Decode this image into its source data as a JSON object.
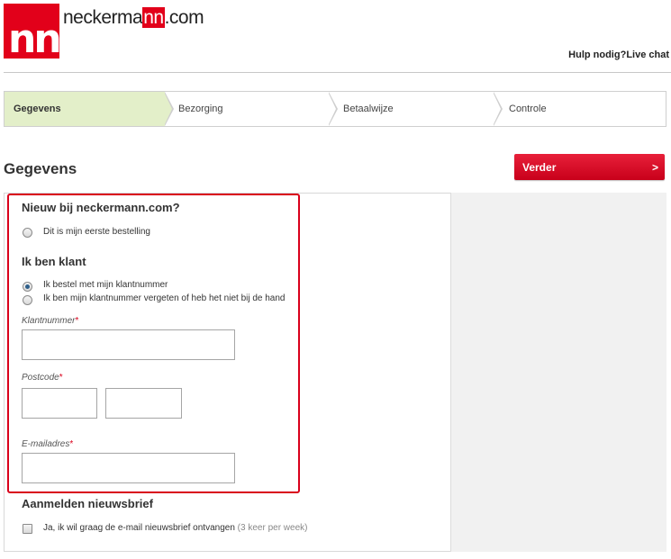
{
  "brand": {
    "logo_text": "nn",
    "name_prefix": "neckerma",
    "name_highlight": "nn",
    "name_suffix": ".com",
    "color": "#e2001a"
  },
  "header": {
    "help_label": "Hulp nodig?",
    "chat_label": "Live chat"
  },
  "steps": [
    {
      "label": "Gegevens",
      "active": true
    },
    {
      "label": "Bezorging",
      "active": false
    },
    {
      "label": "Betaalwijze",
      "active": false
    },
    {
      "label": "Controle",
      "active": false
    }
  ],
  "page": {
    "title": "Gegevens",
    "next_label": "Verder",
    "next_arrow": ">"
  },
  "new_customer": {
    "heading": "Nieuw bij neckermann.com?",
    "option_first_order": "Dit is mijn eerste bestelling"
  },
  "existing_customer": {
    "heading": "Ik ben klant",
    "option_with_number": "Ik bestel met mijn klantnummer",
    "option_forgot_number": "Ik ben mijn klantnummer vergeten of heb het niet bij de hand",
    "selected": "option_with_number"
  },
  "form": {
    "customer_number_label": "Klantnummer",
    "postcode_label": "Postcode",
    "email_label": "E-mailadres",
    "required_marker": "*",
    "customer_number_value": "",
    "postcode_digits_value": "",
    "postcode_letters_value": "",
    "email_value": ""
  },
  "newsletter": {
    "heading": "Aanmelden nieuwsbrief",
    "label": "Ja, ik wil graag de e-mail nieuwsbrief ontvangen",
    "note": "(3 keer per week)",
    "checked": false
  },
  "colors": {
    "accent": "#e2001a",
    "active_step": "#e3efc9",
    "highlight_border": "#d9001b"
  }
}
